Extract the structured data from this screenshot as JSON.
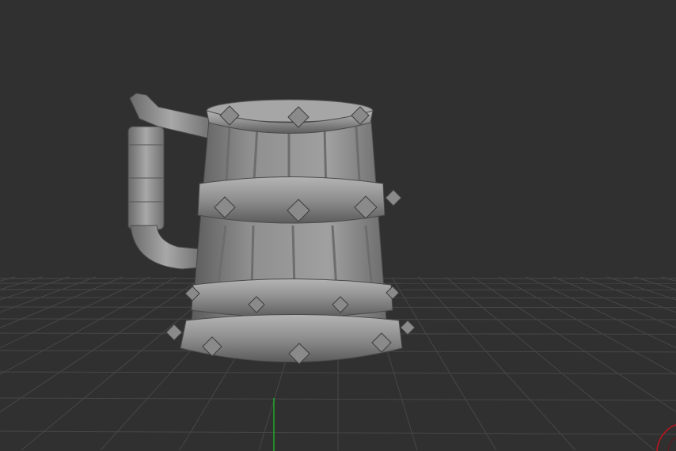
{
  "viewport": {
    "background_color": "#303030",
    "grid_color": "#474747",
    "model_color": "#8e8e8e",
    "y_axis_color": "#1fa82a",
    "gizmo_color": "#c0141c"
  }
}
